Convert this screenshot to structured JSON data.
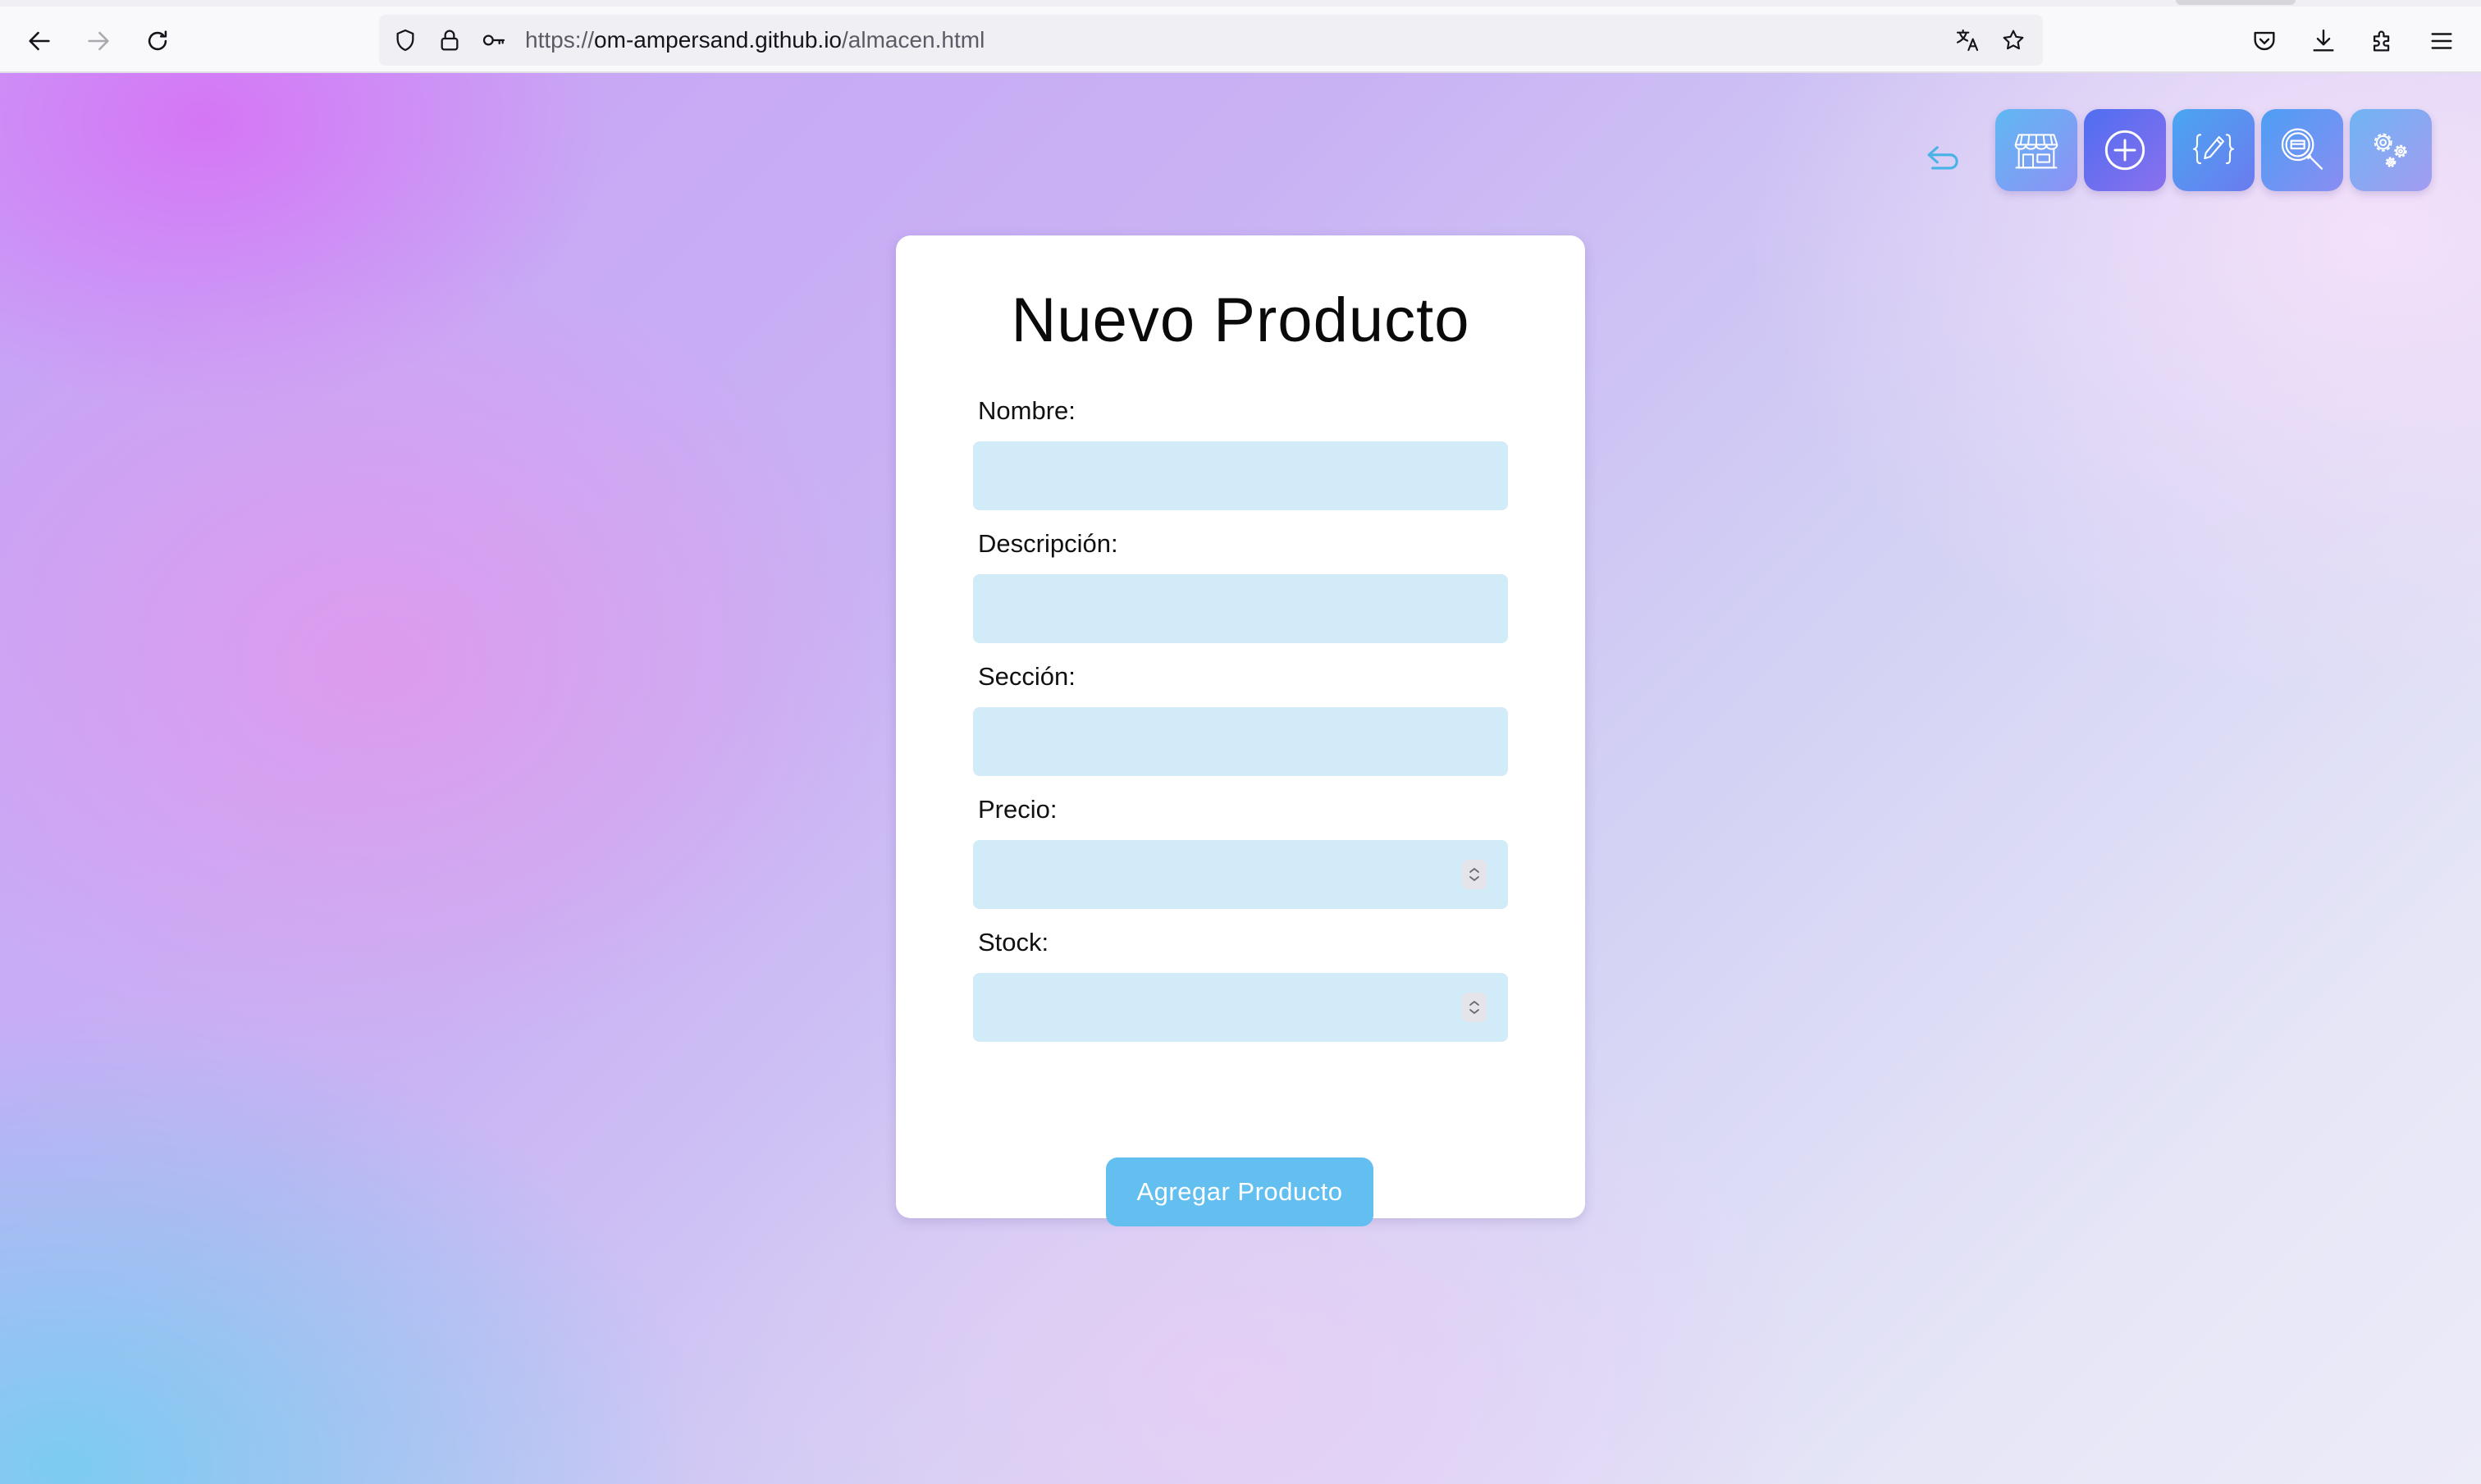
{
  "browser": {
    "url_prefix": "https://",
    "url_host": "om-ampersand.github.io",
    "url_path": "/almacen.html"
  },
  "icons": {
    "back": "arrow-left-icon",
    "forward": "arrow-right-icon",
    "reload": "reload-icon",
    "shield": "shield-icon",
    "lock": "lock-icon",
    "key": "key-icon",
    "translate": "translate-icon",
    "bookmark": "star-icon",
    "pocket": "pocket-icon",
    "downloads": "download-icon",
    "extensions": "puzzle-icon",
    "menu": "hamburger-menu-icon"
  },
  "nav": {
    "back": "return-arrow-icon",
    "tiles": [
      {
        "name": "store-icon",
        "colors": [
          "#5fb8f3",
          "#8f90f4"
        ]
      },
      {
        "name": "plus-circle-icon",
        "colors": [
          "#4f6ef0",
          "#8a70ee"
        ]
      },
      {
        "name": "edit-code-icon",
        "colors": [
          "#4aa6f2",
          "#6b7bee"
        ]
      },
      {
        "name": "search-icon",
        "colors": [
          "#4d9ef4",
          "#8a8df2"
        ]
      },
      {
        "name": "gears-icon",
        "colors": [
          "#6fb4f3",
          "#a39bf2"
        ]
      }
    ]
  },
  "form": {
    "title": "Nuevo Producto",
    "fields": [
      {
        "label": "Nombre:",
        "value": "",
        "type": "text"
      },
      {
        "label": "Descripción:",
        "value": "",
        "type": "text"
      },
      {
        "label": "Sección:",
        "value": "",
        "type": "text"
      },
      {
        "label": "Precio:",
        "value": "",
        "type": "number"
      },
      {
        "label": "Stock:",
        "value": "",
        "type": "number"
      }
    ],
    "submit": "Agregar Producto"
  },
  "colors": {
    "input_bg": "#d1ebf8",
    "button_bg": "#62bff0",
    "back_icon": "#4ab3e6"
  }
}
